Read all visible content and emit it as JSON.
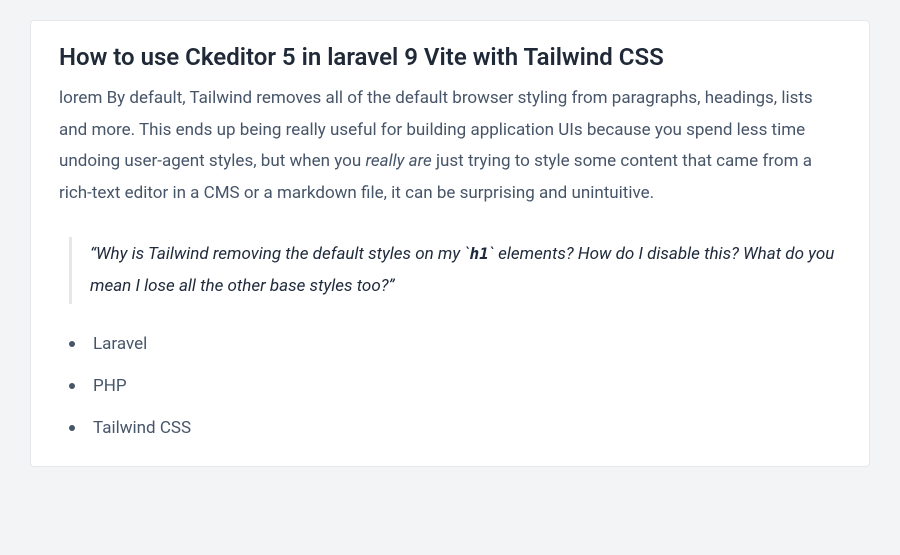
{
  "article": {
    "title": "How to use Ckeditor 5 in laravel 9 Vite with Tailwind CSS",
    "body_pre": "lorem By default, Tailwind removes all of the default browser styling from paragraphs, headings, lists and more. This ends up being really useful for building application UIs because you spend less time undoing user-agent styles, but when you ",
    "body_em": "really are",
    "body_post": " just trying to style some content that came from a rich-text editor in a CMS or a markdown file, it can be surprising and unintuitive.",
    "quote_pre": "“Why is Tailwind removing the default styles on my `",
    "quote_code": "h1",
    "quote_post": "` elements? How do I disable this? What do you mean I lose all the other base styles too?”",
    "list": [
      "Laravel",
      "PHP",
      "Tailwind CSS"
    ]
  }
}
